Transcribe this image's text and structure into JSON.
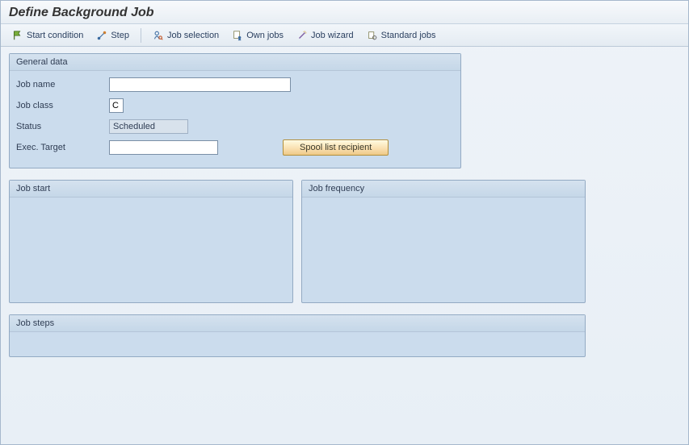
{
  "title": "Define Background Job",
  "toolbar": {
    "start_condition": "Start condition",
    "step": "Step",
    "job_selection": "Job selection",
    "own_jobs": "Own jobs",
    "job_wizard": "Job wizard",
    "standard_jobs": "Standard jobs"
  },
  "general_data": {
    "title": "General data",
    "job_name_label": "Job name",
    "job_name_value": "",
    "job_class_label": "Job class",
    "job_class_value": "C",
    "status_label": "Status",
    "status_value": "Scheduled",
    "exec_target_label": "Exec. Target",
    "exec_target_value": "",
    "spool_button": "Spool list recipient"
  },
  "job_start": {
    "title": "Job start"
  },
  "job_frequency": {
    "title": "Job frequency"
  },
  "job_steps": {
    "title": "Job steps"
  }
}
